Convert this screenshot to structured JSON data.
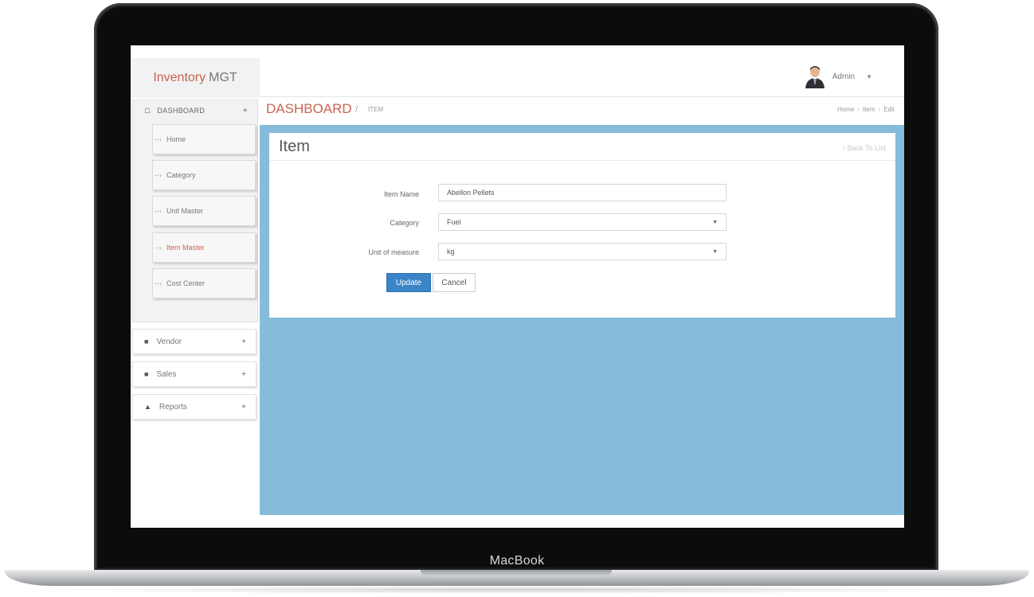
{
  "device": {
    "brand": "MacBook"
  },
  "app": {
    "logo_part1": "Inventory",
    "logo_part2": "MGT"
  },
  "user": {
    "name": "Admin"
  },
  "sidebar": {
    "dashboard": {
      "label": "DASHBOARD",
      "items": [
        {
          "label": "Home"
        },
        {
          "label": "Category"
        },
        {
          "label": "Unit Master"
        },
        {
          "label": "Item Master",
          "active": true
        },
        {
          "label": "Cost Center"
        }
      ]
    },
    "groups": [
      {
        "label": "Vendor",
        "icon": "folder-icon"
      },
      {
        "label": "Sales",
        "icon": "folder-icon"
      },
      {
        "label": "Reports",
        "icon": "chart-icon"
      }
    ]
  },
  "breadcrumb": {
    "title": "DASHBOARD",
    "separator": "/",
    "sub": "ITEM",
    "trail": [
      "Home",
      "Item",
      "Edit"
    ]
  },
  "form": {
    "title": "Item",
    "back_link": "Back To List",
    "fields": {
      "item_name": {
        "label": "Item Name",
        "value": "Abellon Pellets"
      },
      "category": {
        "label": "Category",
        "value": "Fuel"
      },
      "unit": {
        "label": "Unit of measure",
        "value": "kg"
      }
    },
    "update_label": "Update",
    "cancel_label": "Cancel"
  },
  "colors": {
    "accent": "#c8634f",
    "content_bg": "#86bcd9",
    "primary_button": "#3a84c8"
  }
}
